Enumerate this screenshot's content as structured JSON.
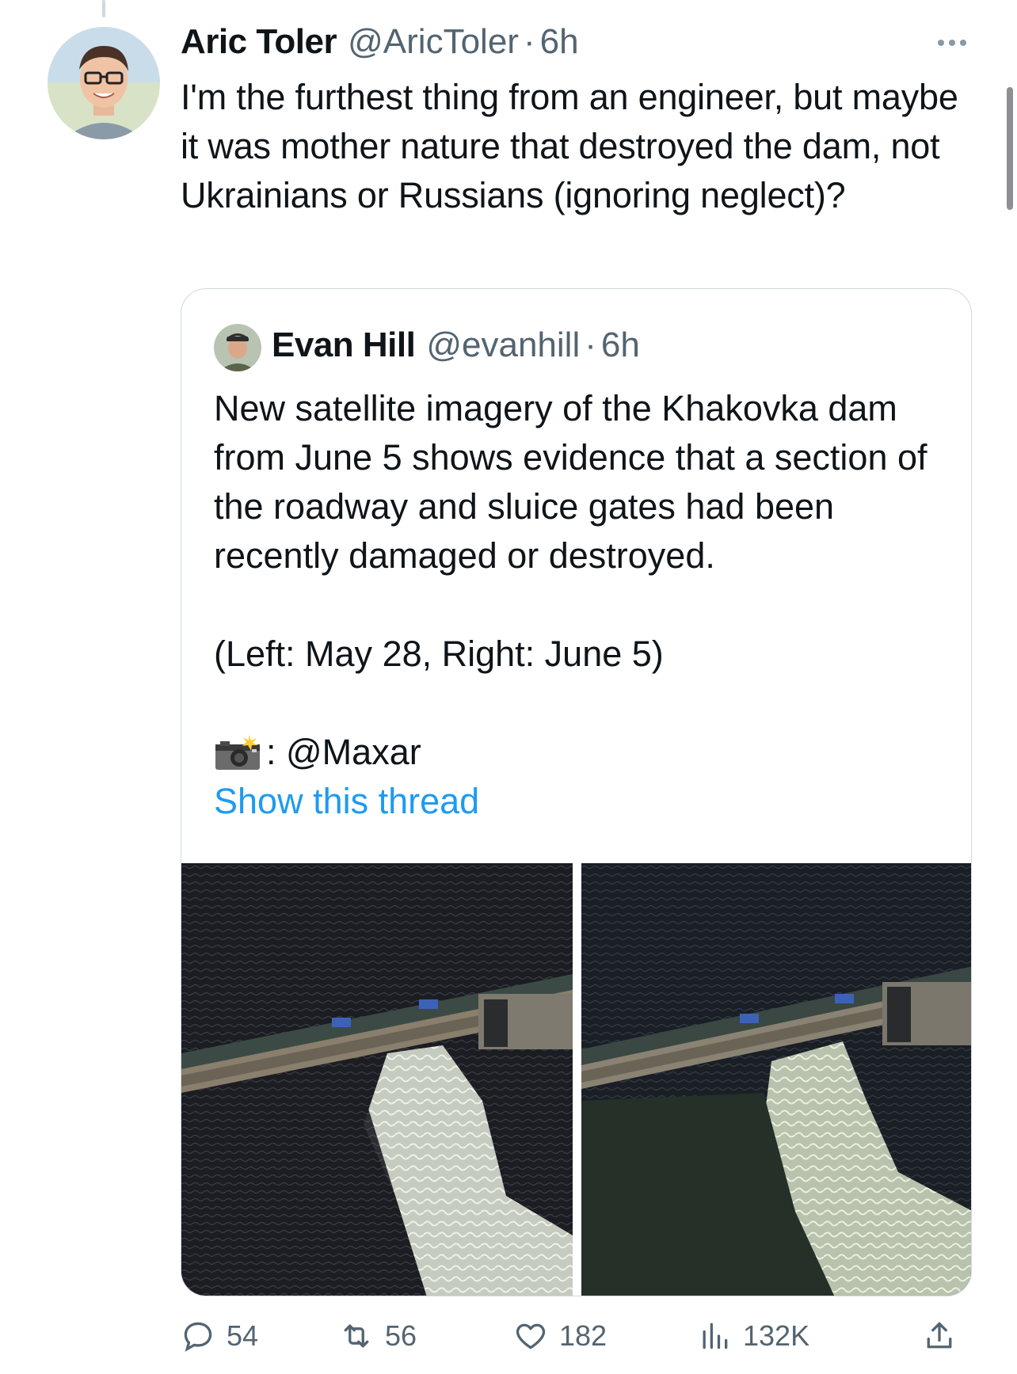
{
  "tweet": {
    "author_name": "Aric Toler",
    "author_handle": "@AricToler",
    "separator": "·",
    "time": "6h",
    "text": "I'm the furthest thing from an engineer, but maybe it was mother nature that destroyed the dam, not Ukrainians or Russians (ignoring neglect)?"
  },
  "quote": {
    "author_name": "Evan Hill",
    "author_handle": "@evanhill",
    "separator": "·",
    "time": "6h",
    "paragraph1": "New satellite imagery of the Khakovka dam from June 5 shows evidence that a section of the roadway and sluice gates had been recently damaged or destroyed.",
    "paragraph2": "(Left: May 28, Right: June 5)",
    "credit": ": @Maxar",
    "show_thread": "Show this thread"
  },
  "actions": {
    "replies": "54",
    "retweets": "56",
    "likes": "182",
    "views": "132K"
  },
  "icons": [
    "more-icon",
    "camera-flash-icon",
    "reply-icon",
    "retweet-icon",
    "like-icon",
    "views-icon",
    "share-icon"
  ],
  "colors": {
    "link": "#1d9bf0",
    "secondary": "#536471",
    "border": "#cfd9de"
  }
}
